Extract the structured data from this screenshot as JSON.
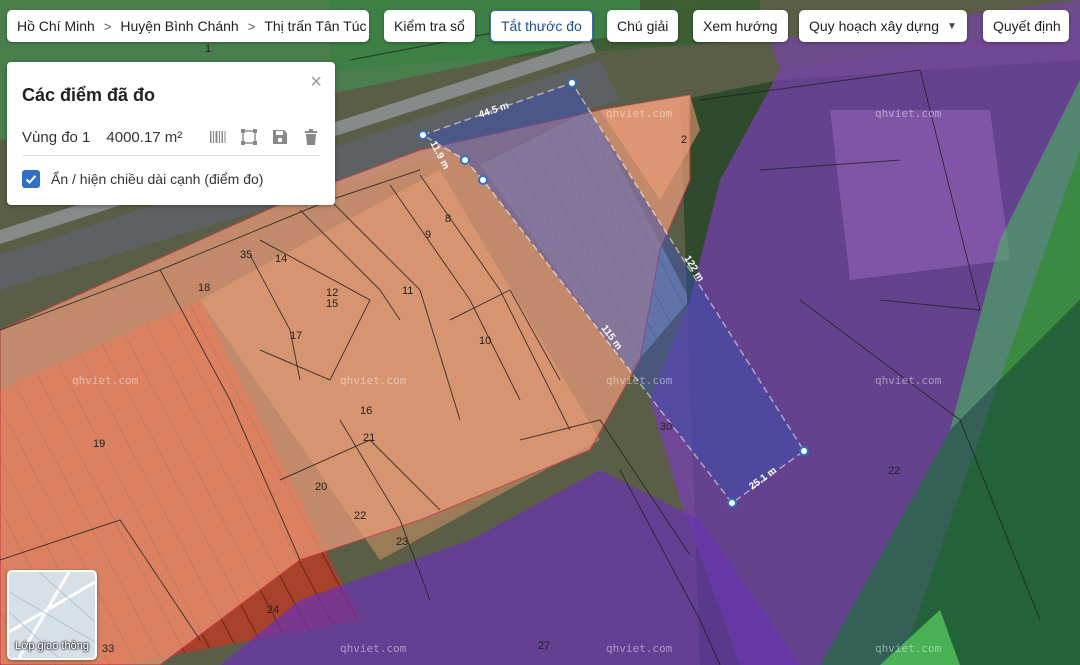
{
  "breadcrumb": {
    "items": [
      "Hồ Chí Minh",
      "Huyện Bình Chánh",
      "Thị trấn Tân Túc"
    ]
  },
  "toolbar": {
    "check_label": "Kiểm tra sổ",
    "measure_off_label": "Tắt thước đo",
    "legend_label": "Chú giải",
    "direction_label": "Xem hướng",
    "planning_label": "Quy hoạch xây dựng",
    "decision_label": "Quyết định"
  },
  "panel": {
    "title": "Các điểm đã đo",
    "area_name": "Vùng đo 1",
    "area_value": "4000.17 m²",
    "toggle_label": "Ẩn / hiện chiều dài cạnh (điểm đo)",
    "toggle_checked": true
  },
  "measurements": {
    "top": "44.5 m",
    "short": "11.9 m",
    "right_long": "122 m",
    "left_long": "115 m",
    "bottom": "25.1 m"
  },
  "plot_numbers": [
    "1",
    "35",
    "14",
    "18",
    "12",
    "15",
    "17",
    "11",
    "9",
    "8",
    "10",
    "16",
    "21",
    "19",
    "20",
    "22",
    "23",
    "24",
    "27",
    "30",
    "2",
    "22",
    "33"
  ],
  "watermark": "qhviet.com",
  "layer_switch": {
    "label": "Lớp giao thông"
  },
  "colors": {
    "residential_orange": "#f4a07c",
    "violet_zone": "#7b3fb8",
    "green_zone": "#2f9a54",
    "measure_fill": "#3a4fb0",
    "accent_blue": "#2f6fc6"
  }
}
